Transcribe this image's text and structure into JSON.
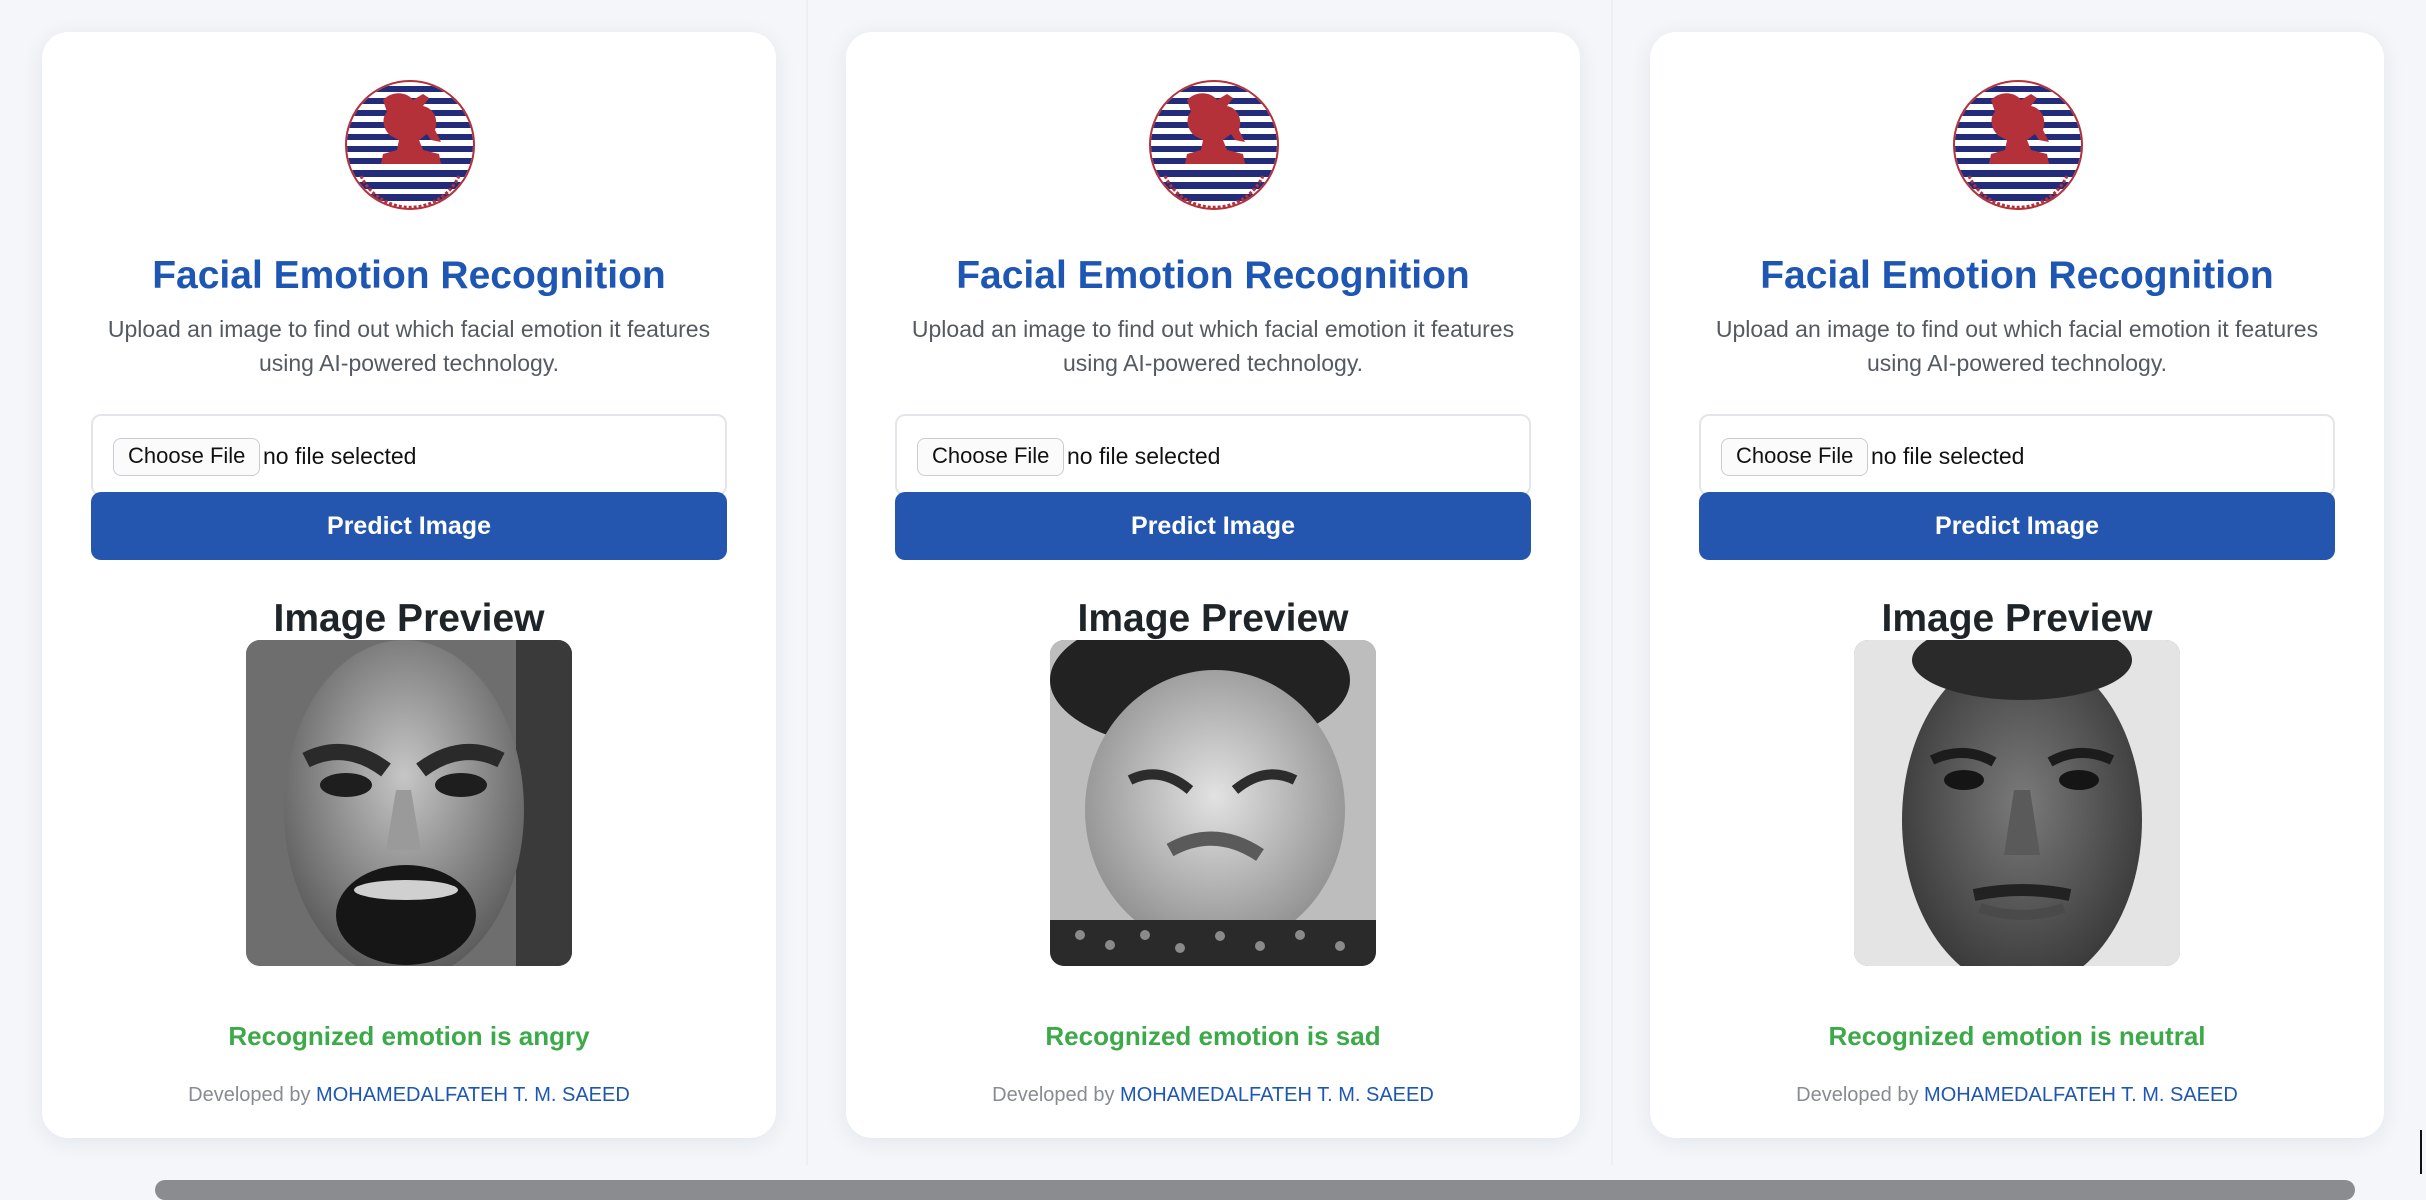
{
  "cards": [
    {
      "logo_icon": "university-seal-icon",
      "title": "Facial Emotion Recognition",
      "description": "Upload an image to find out which facial emotion it features using AI-powered technology.",
      "choose_file_label": "Choose File",
      "file_status": "no file selected",
      "predict_label": "Predict Image",
      "preview_heading": "Image Preview",
      "preview_image": "face-angry-photo",
      "result_text": "Recognized emotion is angry",
      "developed_by_label": "Developed by",
      "developer_name": "MOHAMEDALFATEH T. M. SAEED"
    },
    {
      "logo_icon": "university-seal-icon",
      "title": "Facial Emotion Recognition",
      "description": "Upload an image to find out which facial emotion it features using AI-powered technology.",
      "choose_file_label": "Choose File",
      "file_status": "no file selected",
      "predict_label": "Predict Image",
      "preview_heading": "Image Preview",
      "preview_image": "face-sad-photo",
      "result_text": "Recognized emotion is sad",
      "developed_by_label": "Developed by",
      "developer_name": "MOHAMEDALFATEH T. M. SAEED"
    },
    {
      "logo_icon": "university-seal-icon",
      "title": "Facial Emotion Recognition",
      "description": "Upload an image to find out which facial emotion it features using AI-powered technology.",
      "choose_file_label": "Choose File",
      "file_status": "no file selected",
      "predict_label": "Predict Image",
      "preview_heading": "Image Preview",
      "preview_image": "face-neutral-photo",
      "result_text": "Recognized emotion is neutral",
      "developed_by_label": "Developed by",
      "developer_name": "MOHAMEDALFATEH T. M. SAEED"
    }
  ],
  "colors": {
    "title_blue": "#1e56b4",
    "button_blue": "#2456b0",
    "result_green": "#3daa4a",
    "logo_red": "#b5313a",
    "logo_navy": "#232c7a"
  }
}
